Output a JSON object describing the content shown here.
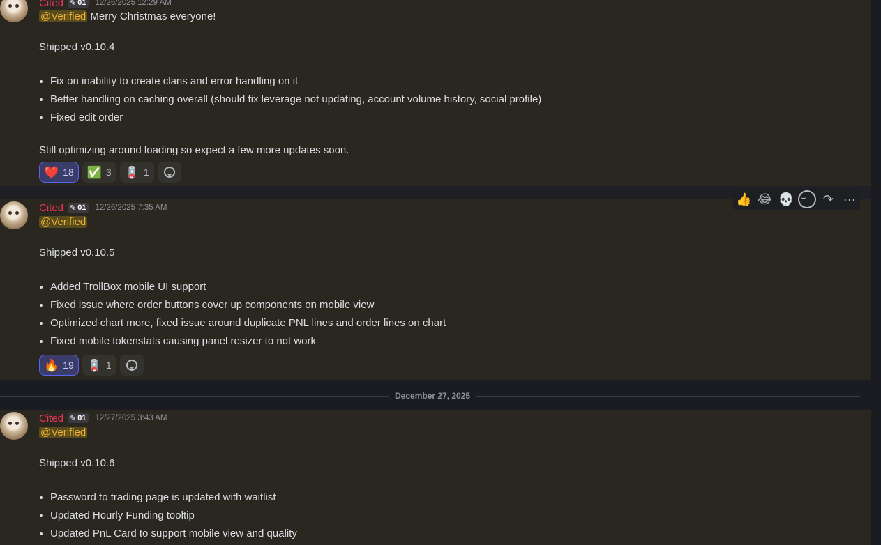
{
  "app": {
    "colors": {
      "background": "#1b1c21",
      "message_highlight": "#2a2620",
      "username": "#f0335a",
      "mention_text": "#f0b232",
      "reaction_active_border": "#5865f2"
    }
  },
  "messages": [
    {
      "author": "Cited",
      "badge": "01",
      "badge_icon": "pen-nib-icon",
      "timestamp": "12/26/2025 12:29 AM",
      "mention": "@Verified",
      "mention_suffix": " Merry Christmas everyone!",
      "title": "Shipped v0.10.4",
      "bullets": [
        "Fix on inability to create clans and error handling on it",
        "Better handling on caching overall (should fix leverage not updating, account volume history, social profile)",
        "Fixed edit order"
      ],
      "footer": "Still optimizing around loading so expect a few more updates soon.",
      "reactions": [
        {
          "emoji": "❤️",
          "icon": "heart-icon",
          "count": "18",
          "active": true
        },
        {
          "emoji": "✅",
          "icon": "check-icon",
          "count": "3",
          "active": false
        },
        {
          "emoji": "🪫",
          "icon": "custom-emoji-icon",
          "count": "1",
          "active": false
        }
      ]
    },
    {
      "author": "Cited",
      "badge": "01",
      "badge_icon": "pen-nib-icon",
      "timestamp": "12/26/2025 7:35 AM",
      "mention": "@Verified",
      "title": "Shipped v0.10.5",
      "bullets": [
        "Added TrollBox mobile UI support",
        "Fixed issue where order buttons cover up components on mobile view",
        "Optimized chart more, fixed issue around duplicate PNL lines and order lines on chart",
        "Fixed mobile tokenstats causing panel resizer to not work"
      ],
      "reactions": [
        {
          "emoji": "🔥",
          "icon": "fire-icon",
          "count": "19",
          "active": true
        },
        {
          "emoji": "🪫",
          "icon": "custom-emoji-icon",
          "count": "1",
          "active": false
        }
      ]
    },
    {
      "author": "Cited",
      "badge": "01",
      "badge_icon": "pen-nib-icon",
      "timestamp": "12/27/2025 3:43 AM",
      "mention": "@Verified",
      "title": "Shipped v0.10.6",
      "bullets": [
        "Password to trading page is updated with waitlist",
        "Updated Hourly Funding tooltip",
        "Updated PnL Card to support mobile view and quality"
      ]
    }
  ],
  "date_divider": "December 27, 2025",
  "hover_toolbar": {
    "quick_reactions": [
      "👍",
      "😂",
      "💀"
    ],
    "actions": [
      "add-reaction-icon",
      "forward-icon",
      "more-icon"
    ],
    "more_glyph": "···",
    "forward_glyph": "↷"
  }
}
